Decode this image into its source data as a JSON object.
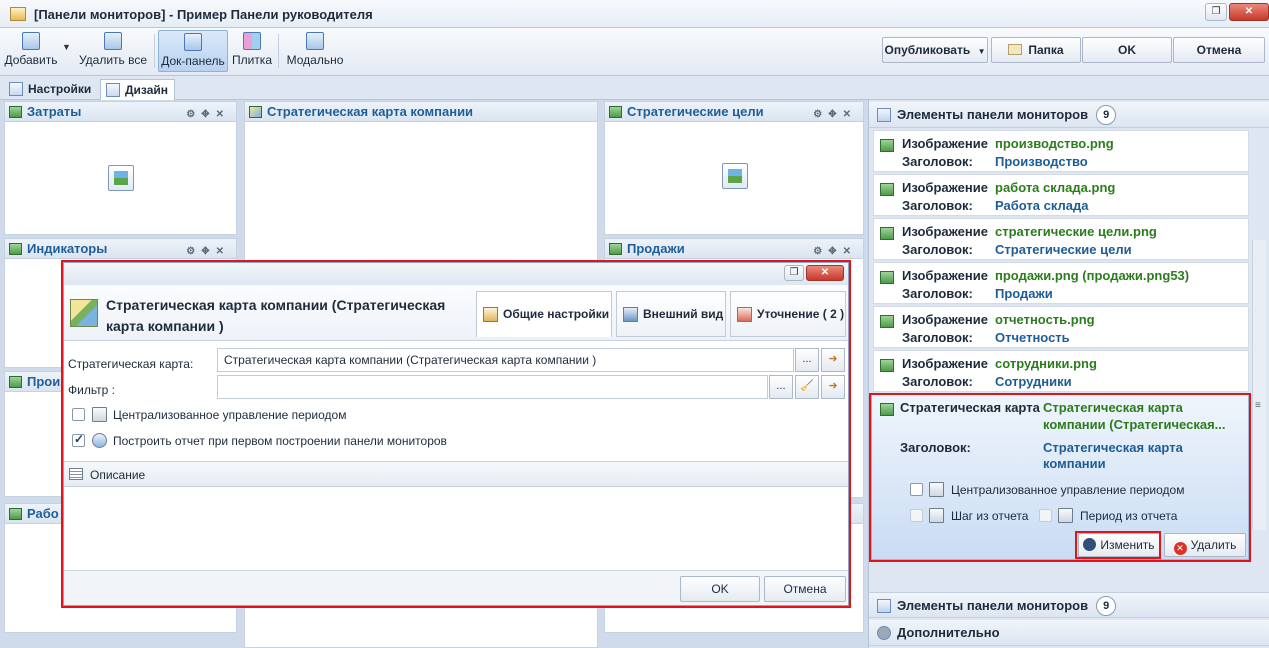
{
  "window": {
    "title": "[Панели мониторов] - Пример Панели руководителя"
  },
  "toolbar": {
    "add": "Добавить",
    "delete_all": "Удалить все",
    "dock_panel": "Док-панель",
    "tile": "Плитка",
    "modal": "Модально",
    "publish": "Опубликовать",
    "folder": "Папка",
    "ok": "OK",
    "cancel": "Отмена"
  },
  "tabs": {
    "settings": "Настройки",
    "design": "Дизайн"
  },
  "panels": {
    "costs": "Затраты",
    "strategy_map": "Стратегическая карта компании",
    "strategic_goals": "Стратегические цели",
    "indicators": "Индикаторы",
    "sales": "Продажи",
    "production_partial": "Прои",
    "work_partial": "Рабо"
  },
  "right_panel": {
    "header": "Элементы панели мониторов",
    "count": "9",
    "items": [
      {
        "key": "Изображение",
        "value": "производство.png",
        "caption_key": "Заголовок:",
        "caption": "Производство"
      },
      {
        "key": "Изображение",
        "value": "работа склада.png",
        "caption_key": "Заголовок:",
        "caption": "Работа склада"
      },
      {
        "key": "Изображение",
        "value": "стратегические цели.png",
        "caption_key": "Заголовок:",
        "caption": "Стратегические цели"
      },
      {
        "key": "Изображение",
        "value": "продажи.png (продажи.png53)",
        "caption_key": "Заголовок:",
        "caption": "Продажи"
      },
      {
        "key": "Изображение",
        "value": "отчетность.png",
        "caption_key": "Заголовок:",
        "caption": "Отчетность"
      },
      {
        "key": "Изображение",
        "value": "сотрудники.png",
        "caption_key": "Заголовок:",
        "caption": "Сотрудники"
      }
    ],
    "selected": {
      "key": "Стратегическая карта",
      "value_line1": "Стратегическая карта",
      "value_line2": "компании (Стратегическая...",
      "caption_key": "Заголовок:",
      "caption_line1": "Стратегическая карта",
      "caption_line2": "компании",
      "central_period": "Централизованное управление периодом",
      "step_from_report": "Шаг из отчета",
      "period_from_report": "Период из отчета",
      "edit": "Изменить",
      "delete": "Удалить"
    },
    "footer1": "Элементы панели мониторов",
    "footer1_count": "9",
    "footer2": "Дополнительно"
  },
  "dialog": {
    "title_line1": "Стратегическая карта компании (Стратегическая",
    "title_line2": "карта компании )",
    "tab_general": "Общие настройки",
    "tab_appearance": "Внешний вид",
    "tab_refine": "Уточнение ( 2 )",
    "strategy_map_label": "Стратегическая карта:",
    "strategy_map_value": "Стратегическая карта компании (Стратегическая карта компании )",
    "filter_label": "Фильтр :",
    "filter_value": "",
    "central_period": "Централизованное управление периодом",
    "build_report": "Построить отчет при первом построении панели мониторов",
    "description": "Описание",
    "ok": "OK",
    "cancel": "Отмена",
    "dots": "..."
  },
  "colors": {
    "accent_red": "#e0141a",
    "link_blue": "#1d5d97",
    "value_green": "#2b7d1c"
  }
}
